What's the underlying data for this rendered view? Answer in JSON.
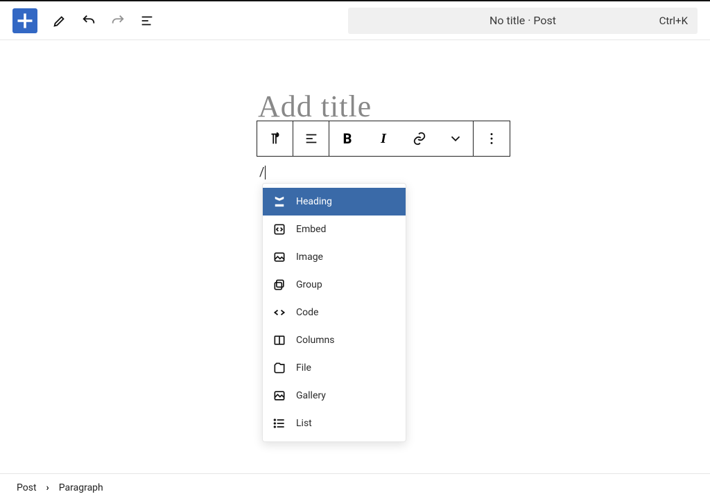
{
  "toolbar": {
    "title_text": "No title · Post",
    "shortcut": "Ctrl+K"
  },
  "editor": {
    "title_placeholder": "Add title",
    "slash": "/"
  },
  "block_toolbar": {
    "buttons": [
      "paragraph",
      "align",
      "bold",
      "italic",
      "link",
      "more-dropdown",
      "kebab"
    ]
  },
  "block_inserter": {
    "items": [
      {
        "icon": "heading",
        "label": "Heading",
        "selected": true
      },
      {
        "icon": "embed",
        "label": "Embed",
        "selected": false
      },
      {
        "icon": "image",
        "label": "Image",
        "selected": false
      },
      {
        "icon": "group",
        "label": "Group",
        "selected": false
      },
      {
        "icon": "code",
        "label": "Code",
        "selected": false
      },
      {
        "icon": "columns",
        "label": "Columns",
        "selected": false
      },
      {
        "icon": "file",
        "label": "File",
        "selected": false
      },
      {
        "icon": "gallery",
        "label": "Gallery",
        "selected": false
      },
      {
        "icon": "list",
        "label": "List",
        "selected": false
      }
    ]
  },
  "breadcrumb": {
    "root": "Post",
    "current": "Paragraph"
  }
}
